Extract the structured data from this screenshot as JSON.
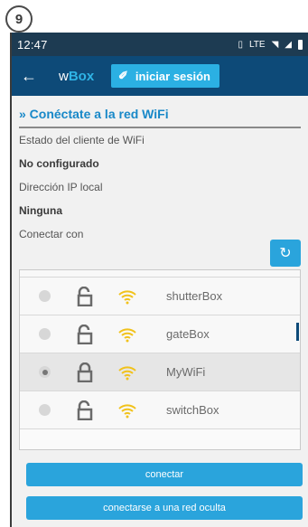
{
  "step_number": "9",
  "status_bar": {
    "time": "12:47",
    "network_label": "LTE"
  },
  "app_bar": {
    "brand_prefix": "w",
    "brand_suffix": "Box",
    "login_label": "iniciar sesión"
  },
  "section": {
    "title": "» Conéctate a la red WiFi"
  },
  "info": {
    "client_status_label": "Estado del cliente de WiFi",
    "client_status_value": "No configurado",
    "ip_label": "Dirección IP local",
    "ip_value": "Ninguna",
    "connect_with_label": "Conectar con"
  },
  "networks": [
    {
      "name": "shutterBox",
      "selected": false,
      "locked": false
    },
    {
      "name": "gateBox",
      "selected": false,
      "locked": false
    },
    {
      "name": "MyWiFi",
      "selected": true,
      "locked": true
    },
    {
      "name": "switchBox",
      "selected": false,
      "locked": false
    }
  ],
  "buttons": {
    "connect": "conectar",
    "hidden_network": "conectarse a una red oculta"
  },
  "colors": {
    "status_bar": "#1d3b52",
    "app_bar": "#0d4a78",
    "accent": "#2aa4dc",
    "title": "#1888c8",
    "wifi_icon": "#f1c21b"
  }
}
